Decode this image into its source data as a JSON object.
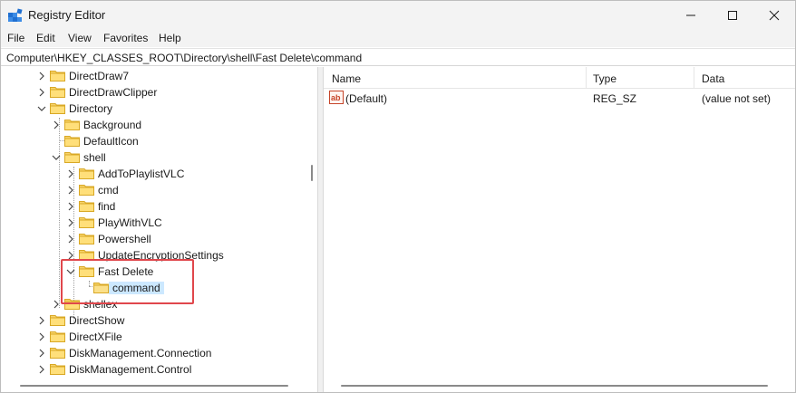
{
  "window": {
    "title": "Registry Editor",
    "accent_color": "#0078d4",
    "highlight_color": "#e0474c"
  },
  "menu": {
    "items": [
      "File",
      "Edit",
      "View",
      "Favorites",
      "Help"
    ]
  },
  "address": {
    "path": "Computer\\HKEY_CLASSES_ROOT\\Directory\\shell\\Fast Delete\\command"
  },
  "tree": {
    "items": [
      {
        "label": "DirectDraw7",
        "expander": "collapsed"
      },
      {
        "label": "DirectDrawClipper",
        "expander": "collapsed"
      },
      {
        "label": "Directory",
        "expander": "expanded"
      },
      {
        "label": "Background",
        "expander": "collapsed"
      },
      {
        "label": "DefaultIcon",
        "expander": "none"
      },
      {
        "label": "shell",
        "expander": "expanded"
      },
      {
        "label": "AddToPlaylistVLC",
        "expander": "collapsed"
      },
      {
        "label": "cmd",
        "expander": "collapsed"
      },
      {
        "label": "find",
        "expander": "collapsed"
      },
      {
        "label": "PlayWithVLC",
        "expander": "collapsed"
      },
      {
        "label": "Powershell",
        "expander": "collapsed"
      },
      {
        "label": "UpdateEncryptionSettings",
        "expander": "collapsed"
      },
      {
        "label": "Fast Delete",
        "expander": "expanded"
      },
      {
        "label": "command",
        "expander": "none",
        "selected": true
      },
      {
        "label": "shellex",
        "expander": "collapsed"
      },
      {
        "label": "DirectShow",
        "expander": "collapsed"
      },
      {
        "label": "DirectXFile",
        "expander": "collapsed"
      },
      {
        "label": "DiskManagement.Connection",
        "expander": "collapsed"
      },
      {
        "label": "DiskManagement.Control",
        "expander": "collapsed"
      }
    ]
  },
  "list": {
    "columns": [
      "Name",
      "Type",
      "Data"
    ],
    "rows": [
      {
        "icon": "string-value-icon",
        "name": "(Default)",
        "type": "REG_SZ",
        "data": "(value not set)"
      }
    ]
  }
}
